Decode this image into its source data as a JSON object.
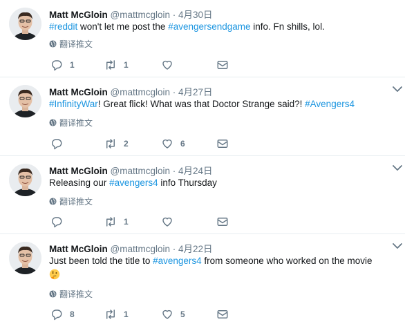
{
  "tweets": [
    {
      "name": "Matt McGloin",
      "handle": "@mattmcgloin",
      "dot": "·",
      "time": "4月30日",
      "text_parts": [
        {
          "t": "#reddit",
          "hash": true
        },
        {
          "t": " won't let me post the ",
          "hash": false
        },
        {
          "t": "#avengersendgame",
          "hash": true
        },
        {
          "t": " info. Fn shills, lol.",
          "hash": false
        }
      ],
      "translate": "翻译推文",
      "replies": "1",
      "retweets": "1",
      "likes": "",
      "has_caret": false,
      "has_emoji": false
    },
    {
      "name": "Matt McGloin",
      "handle": "@mattmcgloin",
      "dot": "·",
      "time": "4月27日",
      "text_parts": [
        {
          "t": "#InfinityWar",
          "hash": true
        },
        {
          "t": "! Great flick! What was that Doctor Strange said?! ",
          "hash": false
        },
        {
          "t": "#Avengers4",
          "hash": true
        }
      ],
      "translate": "翻译推文",
      "replies": "",
      "retweets": "2",
      "likes": "6",
      "has_caret": true,
      "has_emoji": false
    },
    {
      "name": "Matt McGloin",
      "handle": "@mattmcgloin",
      "dot": "·",
      "time": "4月24日",
      "text_parts": [
        {
          "t": "Releasing our ",
          "hash": false
        },
        {
          "t": "#avengers4",
          "hash": true
        },
        {
          "t": " info Thursday",
          "hash": false
        }
      ],
      "translate": "翻译推文",
      "replies": "",
      "retweets": "1",
      "likes": "",
      "has_caret": true,
      "has_emoji": false
    },
    {
      "name": "Matt McGloin",
      "handle": "@mattmcgloin",
      "dot": "·",
      "time": "4月22日",
      "text_parts": [
        {
          "t": "Just been told the title to ",
          "hash": false
        },
        {
          "t": "#avengers4",
          "hash": true
        },
        {
          "t": " from someone who worked on the movie",
          "hash": false
        }
      ],
      "translate": "翻译推文",
      "replies": "8",
      "retweets": "1",
      "likes": "5",
      "has_caret": true,
      "has_emoji": true,
      "emoji": "thinking-face-icon"
    }
  ],
  "colors": {
    "hashtag": "#1b95e0",
    "muted": "#657786",
    "divider": "#e6ecf0"
  }
}
